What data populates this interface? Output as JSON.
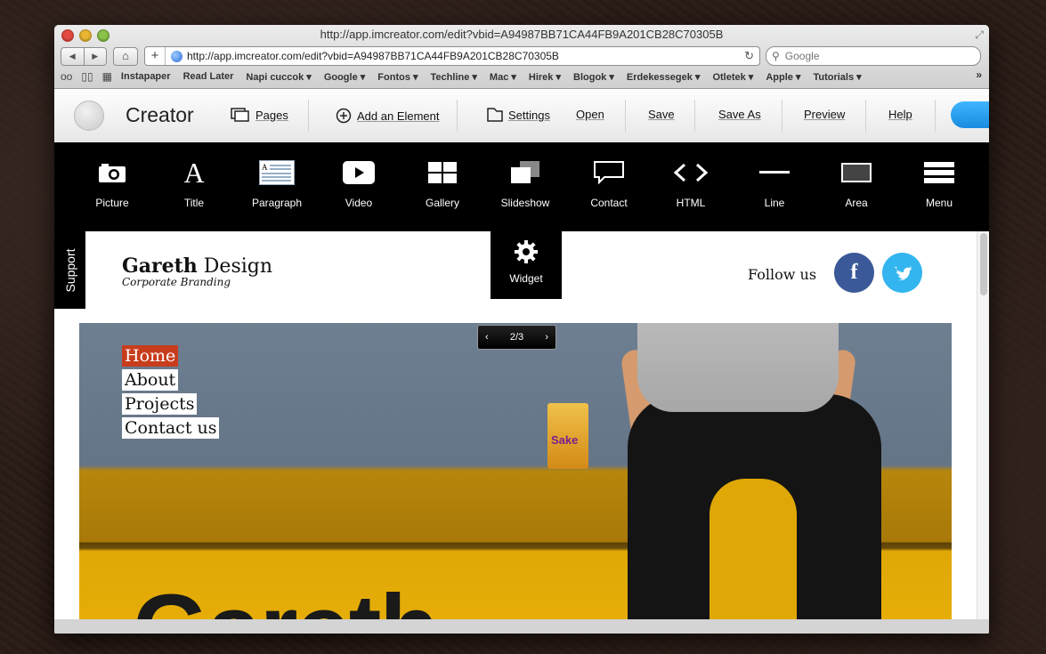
{
  "browser": {
    "window_title": "http://app.imcreator.com/edit?vbid=A94987BB71CA44FB9A201CB28C70305B",
    "url": "http://app.imcreator.com/edit?vbid=A94987BB71CA44FB9A201CB28C70305B",
    "search_placeholder": "Google",
    "bookmarks": [
      "Instapaper",
      "Read Later",
      "Napi cuccok ▾",
      "Google ▾",
      "Fontos ▾",
      "Techline ▾",
      "Mac ▾",
      "Hirek ▾",
      "Blogok ▾",
      "Erdekessegek ▾",
      "Otletek ▾",
      "Apple ▾",
      "Tutorials ▾"
    ]
  },
  "app": {
    "brand": "Creator",
    "menu": {
      "pages": "Pages",
      "add_element": "Add an Element",
      "settings": "Settings",
      "open": "Open",
      "save": "Save",
      "save_as": "Save As",
      "preview": "Preview",
      "help": "Help"
    },
    "elements": [
      "Picture",
      "Title",
      "Paragraph",
      "Video",
      "Gallery",
      "Slideshow",
      "Contact",
      "HTML",
      "Line",
      "Area",
      "Menu"
    ],
    "widget": "Widget",
    "support": "Support",
    "accent_color": "#1a8be0"
  },
  "site": {
    "brand_bold": "Gareth",
    "brand_rest": "Design",
    "tagline": "Corporate Branding",
    "follow": "Follow us",
    "facebook_glyph": "f",
    "slider_counter": "2/3",
    "nav": [
      "Home",
      "About",
      "Projects",
      "Contact us"
    ],
    "nav_active_color": "#c83d1d",
    "hero_partial_text": "Gareth"
  }
}
